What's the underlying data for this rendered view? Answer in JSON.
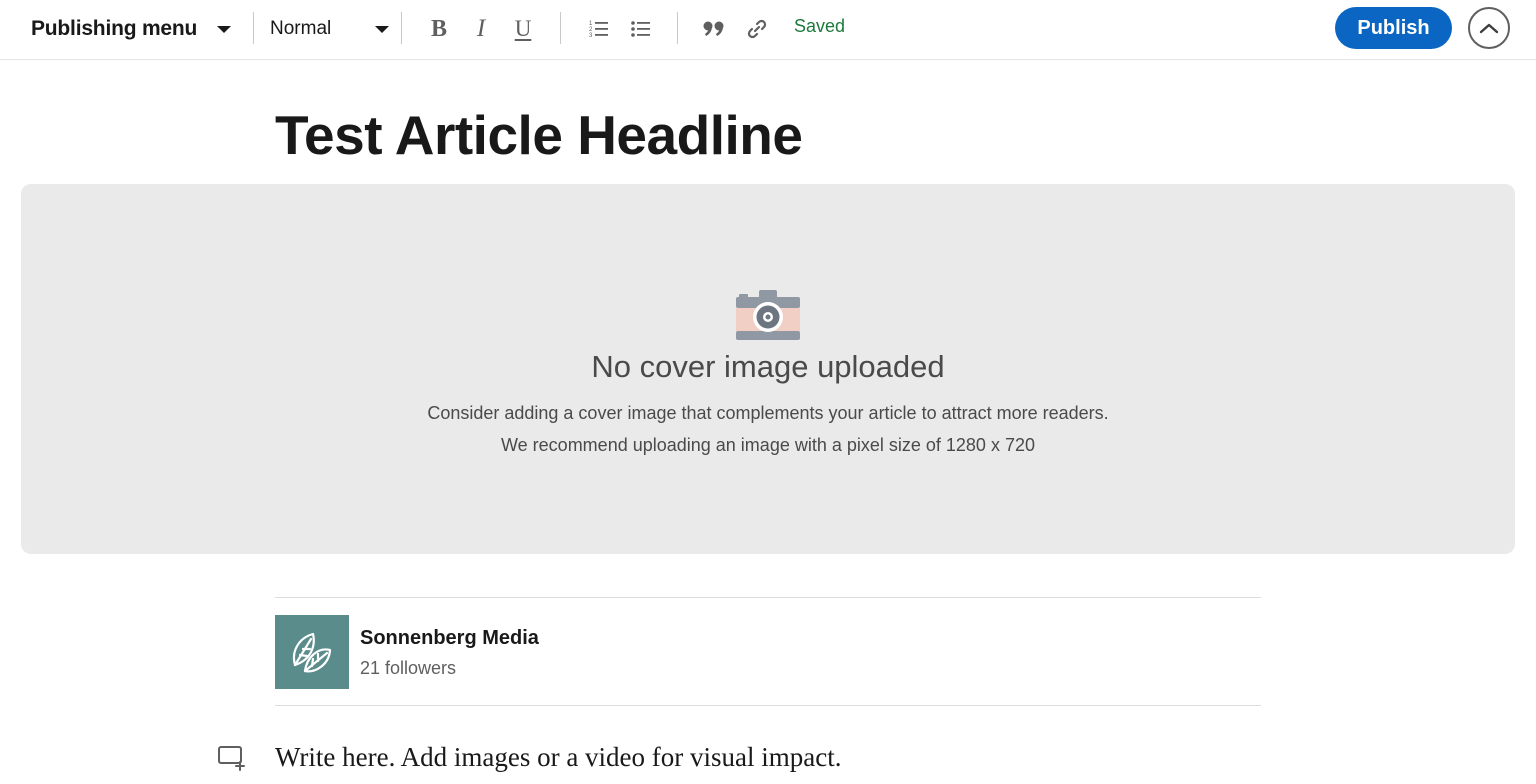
{
  "toolbar": {
    "publishing_menu_label": "Publishing menu",
    "text_style_value": "Normal",
    "buttons": {
      "bold": "B",
      "italic": "I",
      "underline": "U"
    },
    "icons": [
      "bold-icon",
      "italic-icon",
      "underline-icon",
      "numbered-list-icon",
      "bulleted-list-icon",
      "quote-icon",
      "link-icon"
    ],
    "saved_status": "Saved",
    "publish_label": "Publish",
    "collapse_icon": "chevron-up-icon"
  },
  "article": {
    "headline": "Test Article Headline"
  },
  "cover": {
    "icon": "camera-icon",
    "title": "No cover image uploaded",
    "line1": "Consider adding a cover image that complements your article to attract more readers.",
    "line2": "We recommend uploading an image with a pixel size of 1280 x 720"
  },
  "author": {
    "name": "Sonnenberg Media",
    "followers": "21 followers",
    "logo_icon": "leaf-logo-icon"
  },
  "body": {
    "placeholder": "Write here. Add images or a video for visual impact.",
    "add_media_icon": "add-media-icon"
  },
  "colors": {
    "accent": "#0a66c2",
    "saved_green": "#1d7a3c",
    "cover_bg": "#eaeaea",
    "logo_bg": "#5b8c8c"
  }
}
